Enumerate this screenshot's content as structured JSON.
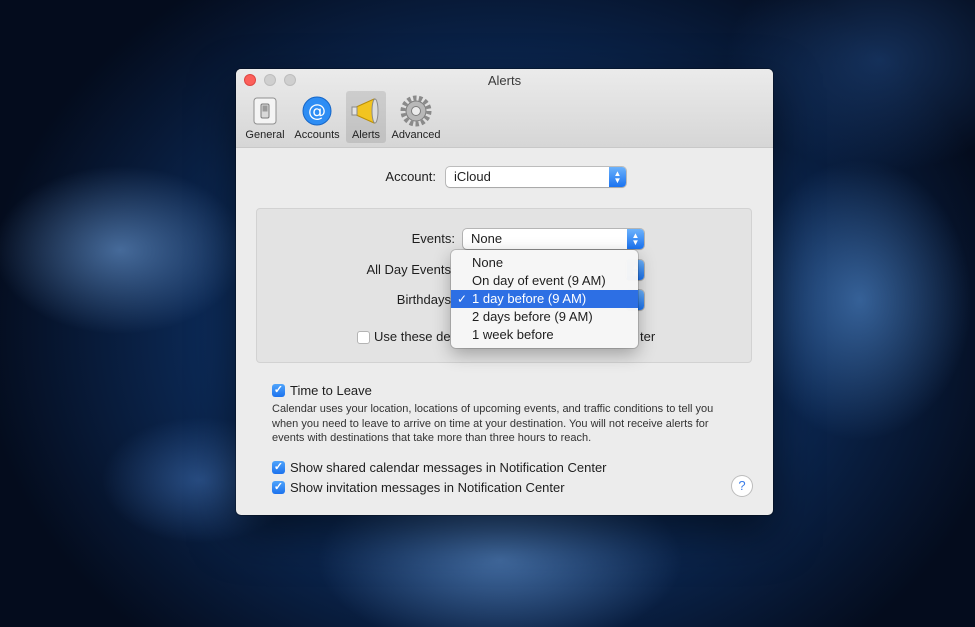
{
  "window": {
    "title": "Alerts"
  },
  "toolbar": [
    {
      "label": "General",
      "icon": "general-switch-icon"
    },
    {
      "label": "Accounts",
      "icon": "at-sign-icon"
    },
    {
      "label": "Alerts",
      "icon": "megaphone-icon"
    },
    {
      "label": "Advanced",
      "icon": "gear-icon"
    }
  ],
  "account": {
    "label": "Account:",
    "value": "iCloud"
  },
  "events": {
    "label": "Events:",
    "value": "None"
  },
  "all_day_events": {
    "label": "All Day Events"
  },
  "birthdays": {
    "label": "Birthdays"
  },
  "use_defaults": {
    "label_visible": "Use these de",
    "label_tail": "ter",
    "checked": false
  },
  "dropdown": {
    "options": [
      "None",
      "On day of event (9 AM)",
      "1 day before (9 AM)",
      "2 days before (9 AM)",
      "1 week before"
    ],
    "selected_index": 2,
    "check": "✓"
  },
  "time_to_leave": {
    "label": "Time to Leave",
    "checked": true,
    "description": "Calendar uses your location, locations of upcoming events, and traffic conditions to tell you when you need to leave to arrive on time at your destination. You will not receive alerts for events with destinations that take more than three hours to reach."
  },
  "shared_messages": {
    "label": "Show shared calendar messages in Notification Center",
    "checked": true
  },
  "invitation_messages": {
    "label": "Show invitation messages in Notification Center",
    "checked": true
  },
  "help": {
    "glyph": "?"
  },
  "colors": {
    "accent": "#2d6fe4",
    "close": "#fc605b"
  }
}
